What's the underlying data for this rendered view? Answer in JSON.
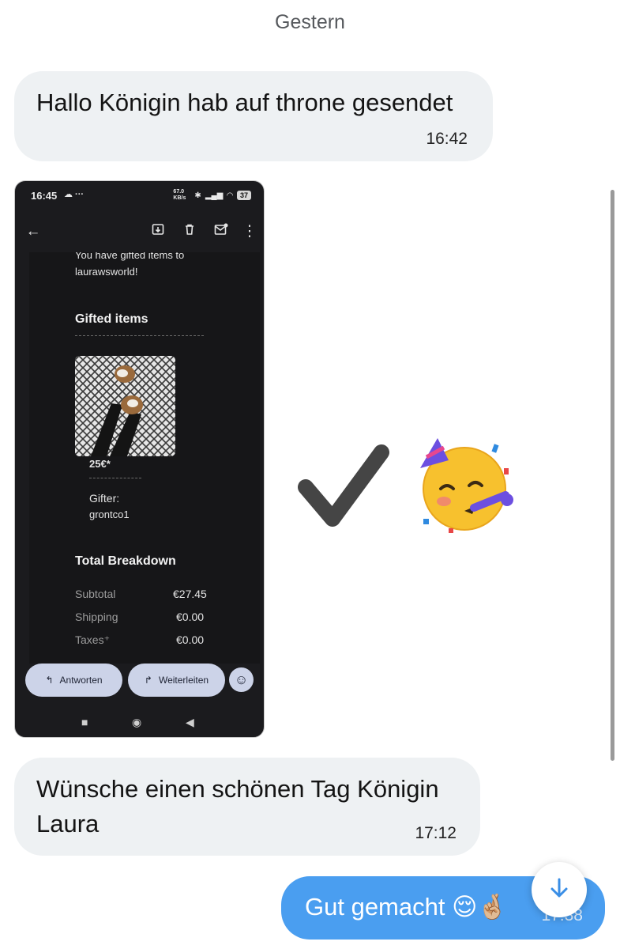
{
  "chat": {
    "date_separator": "Gestern",
    "messages": [
      {
        "text": "Hallo Königin hab auf throne gesendet",
        "time": "16:42",
        "direction": "incoming"
      },
      {
        "attachment": "screenshot"
      },
      {
        "text": "Wünsche einen schönen Tag Königin Laura",
        "time": "17:12",
        "direction": "incoming"
      },
      {
        "text": "Gut gemacht 😌🤞🏼",
        "time": "17:38",
        "direction": "outgoing"
      }
    ],
    "reactions": {
      "checkmark": "check-icon",
      "party": "party-face-emoji"
    }
  },
  "screenshot": {
    "status_time": "16:45",
    "status_extra": "☁ ···",
    "battery": "37",
    "net_speed": "67.0 KB/s",
    "email": {
      "intro": "You have gifted items to",
      "recipient": "laurawsworld!",
      "section_title": "Gifted items",
      "item_price": "25€*",
      "gifter_label": "Gifter:",
      "gifter_name": "grontco1",
      "total_title": "Total Breakdown",
      "rows": [
        {
          "label": "Subtotal",
          "value": "€27.45"
        },
        {
          "label": "Shipping",
          "value": "€0.00"
        },
        {
          "label": "Taxes⁺",
          "value": "€0.00"
        }
      ]
    },
    "actions": {
      "reply": "Antworten",
      "forward": "Weiterleiten"
    }
  },
  "colors": {
    "outgoing_bubble": "#4a9ef0",
    "incoming_bubble": "#eef1f3",
    "fab_arrow": "#3a8ee6"
  }
}
